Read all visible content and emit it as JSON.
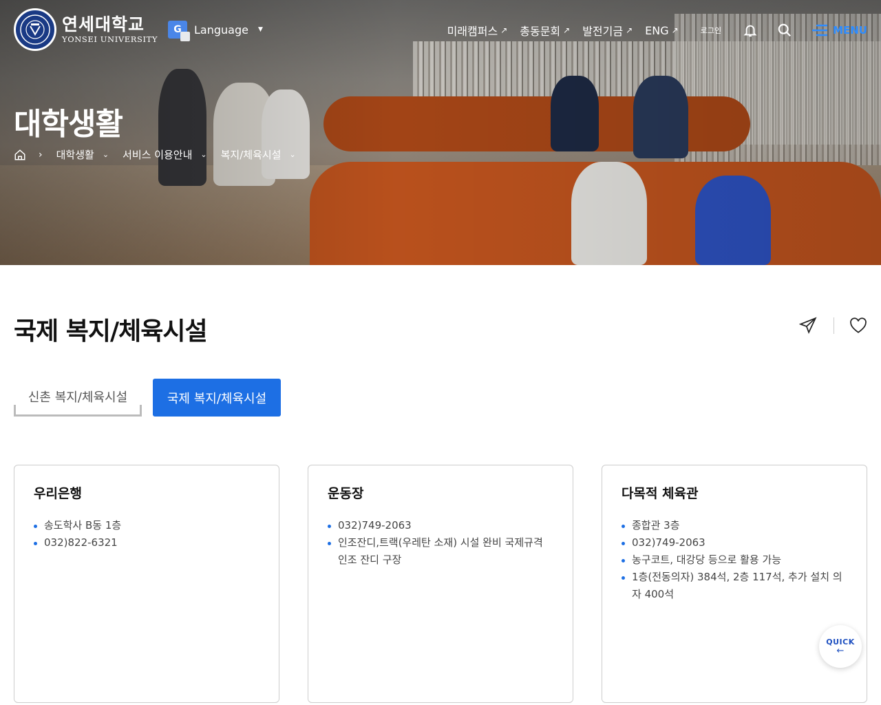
{
  "header": {
    "logo_kr": "연세대학교",
    "logo_en": "YONSEI UNIVERSITY",
    "language_label": "Language",
    "nav_links": [
      {
        "label": "미래캠퍼스"
      },
      {
        "label": "총동문회"
      },
      {
        "label": "발전기금"
      },
      {
        "label": "ENG"
      }
    ],
    "login_label": "로그인",
    "menu_label": "MENU"
  },
  "hero": {
    "title": "대학생활",
    "breadcrumbs": [
      {
        "label": "대학생활"
      },
      {
        "label": "서비스 이용안내"
      },
      {
        "label": "복지/체육시설"
      }
    ]
  },
  "page": {
    "title": "국제 복지/체육시설"
  },
  "tabs": [
    {
      "label": "신촌 복지/체육시설",
      "active": false
    },
    {
      "label": "국제 복지/체육시설",
      "active": true
    }
  ],
  "cards": [
    {
      "title": "우리은행",
      "items": [
        "송도학사 B동 1층",
        "032)822-6321"
      ]
    },
    {
      "title": "운동장",
      "items": [
        "032)749-2063",
        "인조잔디,트랙(우레탄 소재) 시설 완비 국제규격 인조 잔디 구장"
      ]
    },
    {
      "title": "다목적 체육관",
      "items": [
        "종합관 3층",
        "032)749-2063",
        "농구코트, 대강당 등으로 활용 가능",
        "1층(전동의자) 384석, 2층 117석, 추가 설치 의자 400석"
      ]
    }
  ],
  "quick": {
    "label": "QUICK",
    "arrow": "←"
  },
  "colors": {
    "accent": "#1d6fe4",
    "menu": "#2d8cff",
    "seal": "#1a3a85"
  },
  "icons": [
    "google-translate-icon",
    "external-arrow-icon",
    "bell-icon",
    "search-icon",
    "menu-lines-icon",
    "home-icon",
    "chevron-right-icon",
    "chevron-down-icon",
    "share-send-icon",
    "heart-icon"
  ]
}
